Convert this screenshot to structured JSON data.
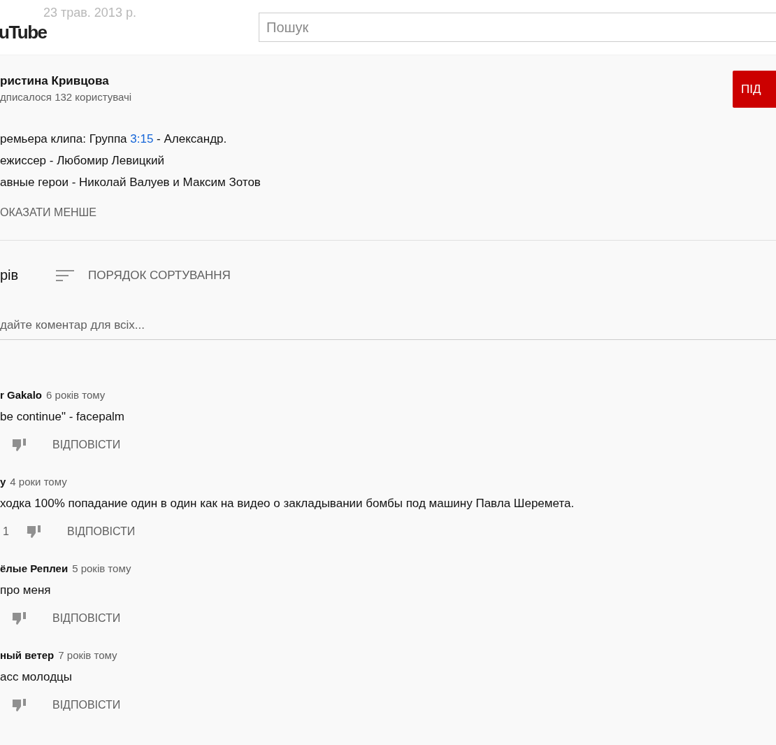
{
  "header": {
    "logo": "uTube",
    "faded_date": "23 трав. 2013 р.",
    "search": {
      "placeholder": "Пошук"
    }
  },
  "channel": {
    "name": "ристина Кривцова",
    "subscribers": "дписалося 132 користувачі",
    "subscribe_button": "ПІД"
  },
  "description": {
    "lines": [
      [
        {
          "kind": "text",
          "text": "ремьера клипа: Группа "
        },
        {
          "kind": "link",
          "text": "3:15"
        },
        {
          "kind": "text",
          "text": " - Александр."
        }
      ],
      [
        {
          "kind": "text",
          "text": "ежиссер - Любомир Левицкий"
        }
      ],
      [
        {
          "kind": "text",
          "text": "авные герои - Николай Валуев и Максим Зотов"
        }
      ]
    ],
    "toggle": "ОКАЗАТИ МЕНШЕ"
  },
  "comments_header": {
    "count": "рів",
    "sort": "ПОРЯДОК СОРТУВАННЯ"
  },
  "comment_box": {
    "placeholder": "дайте коментар для всіх..."
  },
  "comments": [
    {
      "author": "r Gakalo",
      "time": "6 років тому",
      "text": "be continue\" - facepalm",
      "reply": "ВІДПОВІСТИ"
    },
    {
      "author": "y",
      "time": "4 роки тому",
      "text": "ходка 100% попадание один в один как  на видео о закладывании бомбы под машину Павла Шеремета.",
      "likes": "1",
      "reply": "ВІДПОВІСТИ"
    },
    {
      "author": "ёлые Реплеи",
      "time": "5 років тому",
      "text": "про меня",
      "reply": "ВІДПОВІСТИ"
    },
    {
      "author": "ный ветер",
      "time": "7 років тому",
      "text": "асс молодцы",
      "reply": "ВІДПОВІСТИ"
    }
  ]
}
